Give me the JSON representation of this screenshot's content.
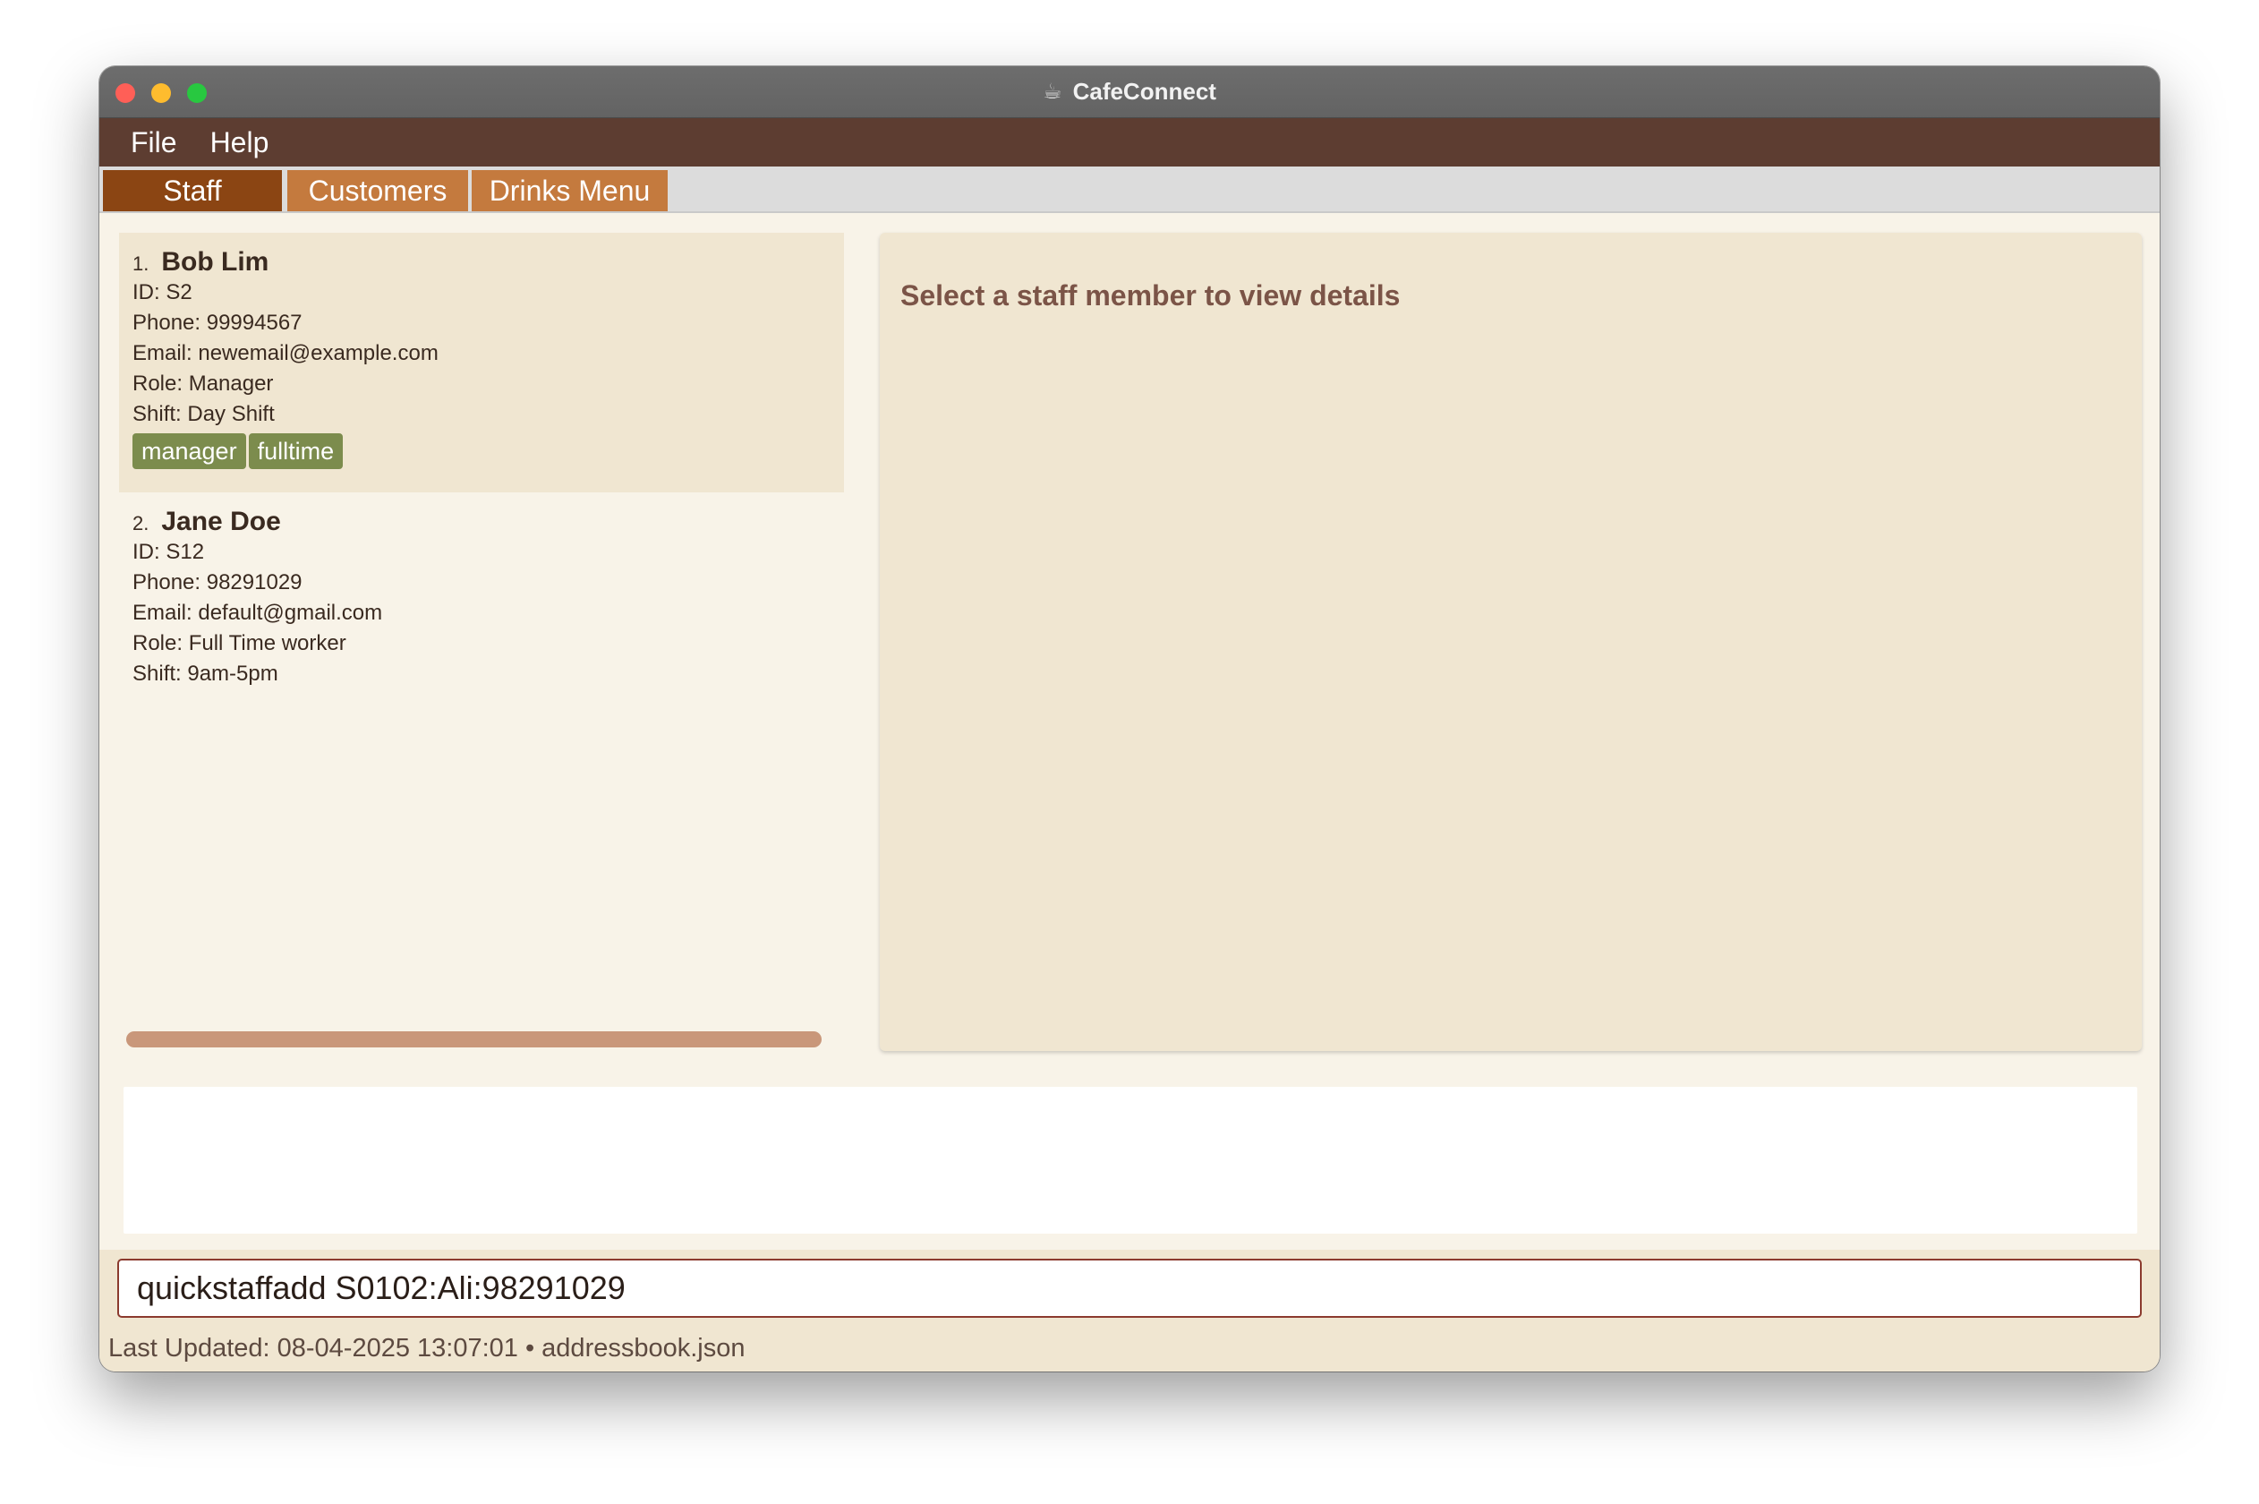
{
  "window": {
    "title": "CafeConnect",
    "title_icon": "coffee-cup-icon"
  },
  "menu": [
    "File",
    "Help"
  ],
  "tabs": [
    {
      "label": "Staff",
      "active": true
    },
    {
      "label": "Customers",
      "active": false
    },
    {
      "label": "Drinks Menu",
      "active": false
    }
  ],
  "staff": [
    {
      "index": "1.",
      "name": "Bob Lim",
      "id": "ID: S2",
      "phone": "Phone: 99994567",
      "email": "Email: newemail@example.com",
      "role": "Role: Manager",
      "shift": "Shift: Day Shift",
      "tags": [
        "manager",
        "fulltime"
      ]
    },
    {
      "index": "2.",
      "name": "Jane Doe",
      "id": "ID: S12",
      "phone": "Phone: 98291029",
      "email": "Email: default@gmail.com",
      "role": "Role: Full Time worker",
      "shift": "Shift: 9am-5pm",
      "tags": []
    }
  ],
  "detail": {
    "placeholder": "Select a staff member to view details"
  },
  "result": {
    "text": ""
  },
  "command": {
    "value": "quickstaffadd S0102:Ali:98291029"
  },
  "status": {
    "text": "Last Updated: 08-04-2025 13:07:01 • addressbook.json"
  },
  "colors": {
    "menubar": "#5d3d31",
    "tab_active": "#8b4513",
    "tab_inactive": "#c47a3e",
    "tag": "#7c8c4d",
    "panel": "#f0e6d1",
    "background": "#f8f3e8"
  }
}
